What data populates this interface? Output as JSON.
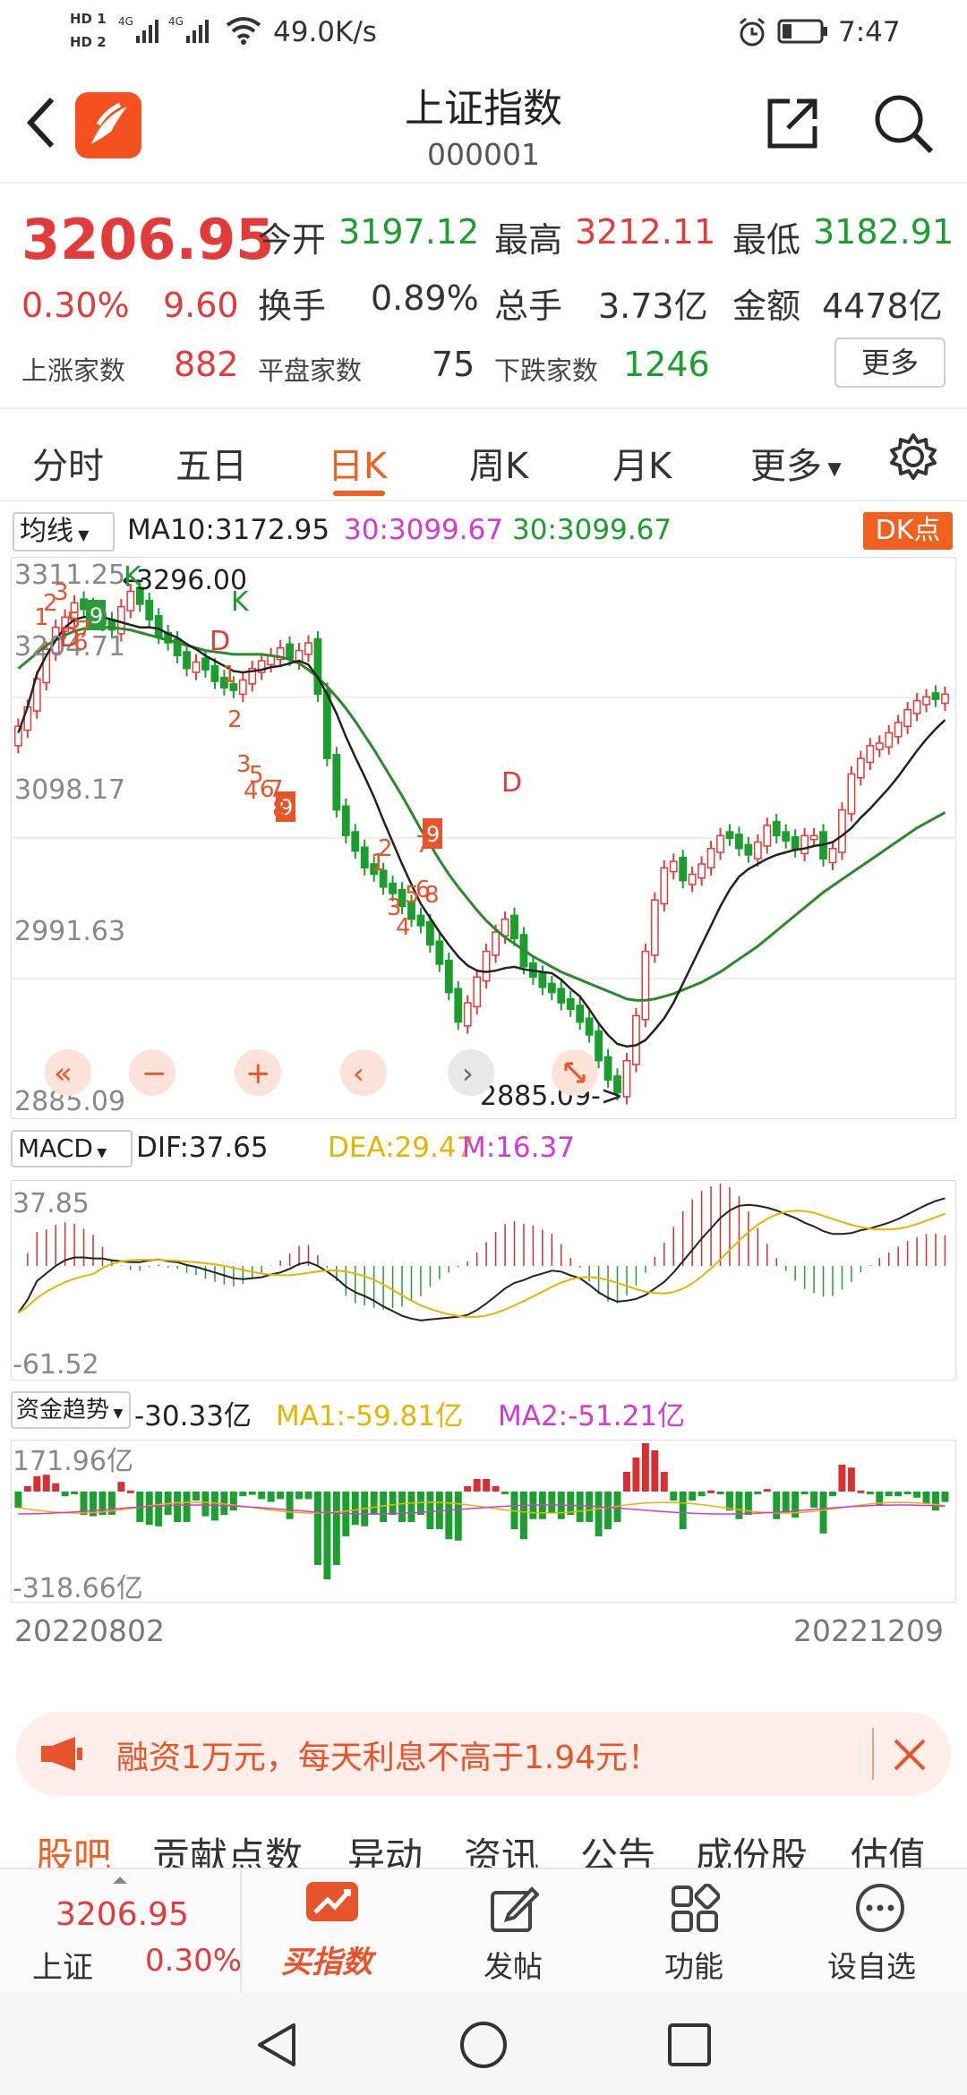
{
  "status": {
    "hd1": "HD 1",
    "hd2": "HD 2",
    "net": "4G",
    "speed": "49.0K/s",
    "time": "7:47"
  },
  "header": {
    "title": "上证指数",
    "code": "000001"
  },
  "quote": {
    "price": "3206.95",
    "change_pct": "0.30%",
    "change": "9.60",
    "open_label": "今开",
    "open": "3197.12",
    "high_label": "最高",
    "high": "3212.11",
    "low_label": "最低",
    "low": "3182.91",
    "turnover_label": "换手",
    "turnover": "0.89%",
    "volume_label": "总手",
    "volume": "3.73亿",
    "amount_label": "金额",
    "amount": "4478亿",
    "up_label": "上涨家数",
    "up": "882",
    "flat_label": "平盘家数",
    "flat": "75",
    "down_label": "下跌家数",
    "down": "1246",
    "more_button": "更多"
  },
  "tabs": [
    "分时",
    "五日",
    "日K",
    "周K",
    "月K",
    "更多"
  ],
  "active_tab": 2,
  "indicators": {
    "ma_select": "均线",
    "ma10": "MA10:3172.95",
    "ma30a": "30:3099.67",
    "ma30b": "30:3099.67",
    "dk_button": "DK点",
    "macd_select": "MACD",
    "dif": "DIF:37.65",
    "dea": "DEA:29.47",
    "m": "M:16.37",
    "fund_select": "资金趋势",
    "fund": "-30.33亿",
    "fma1": "MA1:-59.81亿",
    "fma2": "MA2:-51.21亿"
  },
  "chart_data": [
    {
      "type": "candlestick",
      "ylim": [
        2885.09,
        3311.25
      ],
      "y_ticks": [
        "3311.25",
        "3204.71",
        "3098.17",
        "2991.63",
        "2885.09"
      ],
      "annotations": {
        "high_marker": "3296.00",
        "low_marker": "2885.09->"
      },
      "x_start": "20220802",
      "x_end": "20221209",
      "closes": [
        3185,
        3200,
        3222,
        3245,
        3262,
        3270,
        3281,
        3276,
        3270,
        3265,
        3260,
        3278,
        3290,
        3280,
        3268,
        3255,
        3250,
        3240,
        3230,
        3235,
        3229,
        3220,
        3215,
        3213,
        3221,
        3230,
        3236,
        3240,
        3246,
        3238,
        3244,
        3250,
        3210,
        3160,
        3120,
        3100,
        3088,
        3075,
        3070,
        3060,
        3055,
        3045,
        3035,
        3030,
        3015,
        3000,
        2978,
        2955,
        2970,
        2990,
        3010,
        3025,
        3035,
        3020,
        2998,
        2990,
        2982,
        2978,
        2970,
        2965,
        2955,
        2945,
        2925,
        2910,
        2900,
        2925,
        2960,
        3010,
        3050,
        3075,
        3080,
        3065,
        3070,
        3078,
        3090,
        3100,
        3098,
        3090,
        3085,
        3095,
        3108,
        3100,
        3096,
        3089,
        3100,
        3100,
        3082,
        3090,
        3120,
        3148,
        3160,
        3170,
        3172,
        3180,
        3188,
        3198,
        3205,
        3208,
        3206,
        3210
      ],
      "series": [
        {
          "name": "MA10",
          "values": [
            3180,
            3200,
            3226,
            3240,
            3252,
            3262,
            3268,
            3270,
            3270,
            3270,
            3268,
            3266,
            3264,
            3262,
            3262,
            3261,
            3257,
            3254,
            3249,
            3245,
            3240,
            3236,
            3232,
            3228,
            3227,
            3228,
            3229,
            3231,
            3232,
            3234,
            3236,
            3233,
            3223,
            3210,
            3195,
            3177,
            3161,
            3146,
            3130,
            3112,
            3095,
            3078,
            3062,
            3047,
            3036,
            3025,
            3015,
            3006,
            2999,
            2995,
            2994,
            2995,
            2997,
            2998,
            2996,
            2995,
            2994,
            2993,
            2988,
            2981,
            2975,
            2965,
            2954,
            2945,
            2938,
            2936,
            2937,
            2941,
            2949,
            2958,
            2970,
            2985,
            3000,
            3015,
            3030,
            3045,
            3058,
            3068,
            3074,
            3078,
            3082,
            3085,
            3087,
            3089,
            3090,
            3092,
            3093,
            3095,
            3100,
            3106,
            3114,
            3121,
            3129,
            3137,
            3146,
            3156,
            3166,
            3175,
            3183,
            3190
          ]
        },
        {
          "name": "30",
          "values": [
            3230,
            3236,
            3242,
            3248,
            3252,
            3256,
            3259,
            3261,
            3262,
            3262,
            3262,
            3261,
            3260,
            3258,
            3256,
            3254,
            3252,
            3250,
            3248,
            3246,
            3244,
            3243,
            3242,
            3241,
            3241,
            3241,
            3241,
            3240,
            3239,
            3237,
            3234,
            3229,
            3223,
            3216,
            3208,
            3199,
            3189,
            3178,
            3167,
            3155,
            3143,
            3131,
            3118,
            3105,
            3093,
            3081,
            3070,
            3060,
            3051,
            3042,
            3034,
            3027,
            3021,
            3016,
            3011,
            3006,
            3002,
            2998,
            2994,
            2991,
            2988,
            2985,
            2982,
            2979,
            2976,
            2973,
            2972,
            2972,
            2973,
            2975,
            2977,
            2980,
            2983,
            2986,
            2990,
            2994,
            2999,
            3004,
            3009,
            3014,
            3020,
            3026,
            3032,
            3038,
            3044,
            3050,
            3056,
            3061,
            3066,
            3071,
            3076,
            3081,
            3086,
            3091,
            3096,
            3101,
            3106,
            3110,
            3114,
            3118
          ]
        }
      ]
    },
    {
      "type": "bar",
      "name": "MACD",
      "ylim": [
        -61.52,
        37.85
      ],
      "y_ticks": [
        "37.85",
        "-61.52"
      ]
    },
    {
      "type": "bar",
      "name": "资金趋势",
      "ylim": [
        -318.66,
        171.96
      ],
      "y_ticks": [
        "171.96亿",
        "-318.66亿"
      ]
    }
  ],
  "chart_overlay": {
    "zoom_out": "−",
    "zoom_in": "+"
  },
  "banner": {
    "text": "融资1万元，每天利息不高于1.94元！"
  },
  "subtabs": [
    "股吧",
    "贡献点数",
    "异动",
    "资讯",
    "公告",
    "成份股",
    "估值"
  ],
  "bottombar": {
    "price": "3206.95",
    "name": "上证",
    "pct": "0.30%",
    "trade": "买指数",
    "post": "发帖",
    "func": "功能",
    "watch": "设自选"
  },
  "colors": {
    "up": "#e33a3a",
    "down": "#1a9e2e",
    "accent": "#f0601e",
    "ma10": "#222222",
    "ma30": "#2a8a2a",
    "dea": "#e8b400",
    "m": "#d23ad2"
  }
}
